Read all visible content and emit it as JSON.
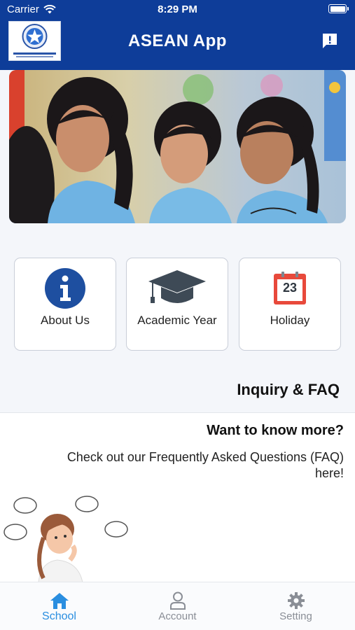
{
  "status_bar": {
    "carrier": "Carrier",
    "time": "8:29 PM"
  },
  "header": {
    "title": "ASEAN App",
    "logo_icon": "school-logo-icon",
    "feedback_icon": "feedback-icon",
    "background_color": "#0e3d99"
  },
  "banner": {
    "image": "students-photo"
  },
  "tiles": [
    {
      "label": "About Us",
      "icon": "info-icon"
    },
    {
      "label": "Academic Year",
      "icon": "graduation-cap-icon"
    },
    {
      "label": "Holiday",
      "icon": "calendar-icon",
      "calendar_day": "23"
    }
  ],
  "inquiry": {
    "section_title": "Inquiry & FAQ",
    "heading": "Want to know more?",
    "description": "Check out our Frequently Asked Questions (FAQ) here!",
    "illustration": "thinking-girl-illustration"
  },
  "tabbar": {
    "items": [
      {
        "label": "School",
        "icon": "home-icon",
        "active": true
      },
      {
        "label": "Account",
        "icon": "user-icon",
        "active": false
      },
      {
        "label": "Setting",
        "icon": "gear-icon",
        "active": false
      }
    ],
    "active_color": "#2a8ee0",
    "inactive_color": "#8a8e96"
  }
}
